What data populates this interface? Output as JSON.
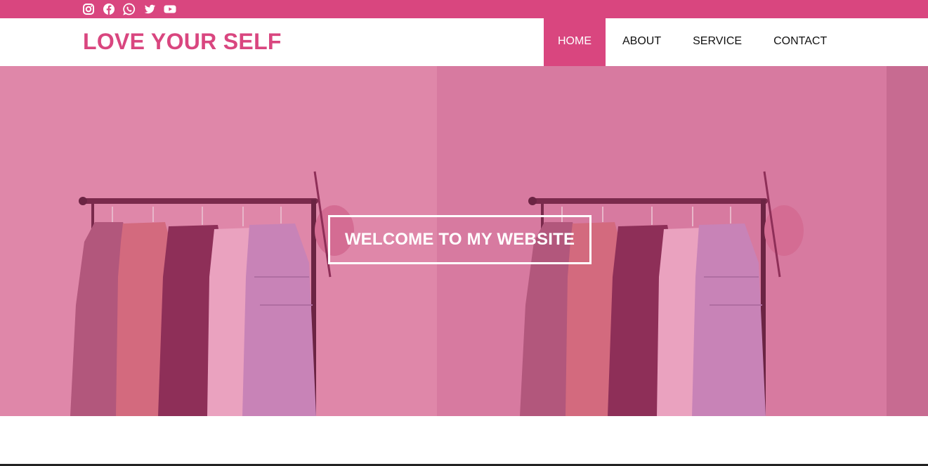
{
  "social": {
    "icons": [
      "instagram-icon",
      "facebook-icon",
      "whatsapp-icon",
      "twitter-icon",
      "youtube-icon"
    ]
  },
  "header": {
    "logo": "LOVE YOUR SELF"
  },
  "nav": {
    "items": [
      {
        "label": "HOME",
        "active": true
      },
      {
        "label": "ABOUT",
        "active": false
      },
      {
        "label": "SERVICE",
        "active": false
      },
      {
        "label": "CONTACT",
        "active": false
      }
    ]
  },
  "hero": {
    "button_label": "WELCOME TO MY WEBSITE"
  },
  "colors": {
    "brand_pink": "#d9467f",
    "hero_overlay": "#dd86a8",
    "white": "#ffffff",
    "text_dark": "#111111"
  }
}
